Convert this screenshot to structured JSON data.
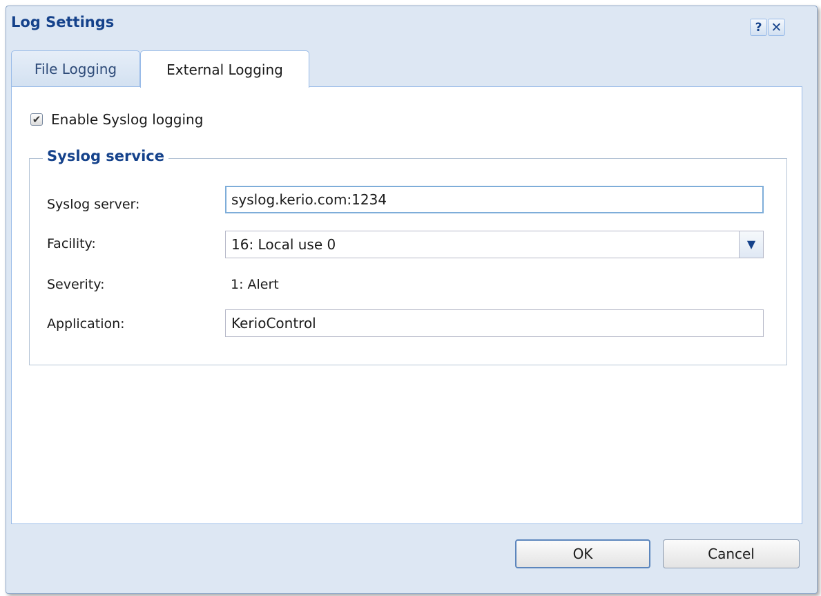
{
  "dialog": {
    "title": "Log Settings",
    "help_glyph": "?",
    "close_glyph": "✕"
  },
  "tabs": [
    {
      "label": "File Logging",
      "active": false
    },
    {
      "label": "External Logging",
      "active": true
    }
  ],
  "syslog": {
    "enable_label": "Enable Syslog logging",
    "enabled": true,
    "group_title": "Syslog service",
    "server_label": "Syslog server:",
    "server_value": "syslog.kerio.com:1234",
    "facility_label": "Facility:",
    "facility_value": "16: Local use 0",
    "severity_label": "Severity:",
    "severity_value": "1: Alert",
    "application_label": "Application:",
    "application_value": "KerioControl"
  },
  "buttons": {
    "ok": "OK",
    "cancel": "Cancel"
  },
  "colors": {
    "accent": "#15428b",
    "frame": "#dde7f3",
    "border": "#99bbe8"
  }
}
